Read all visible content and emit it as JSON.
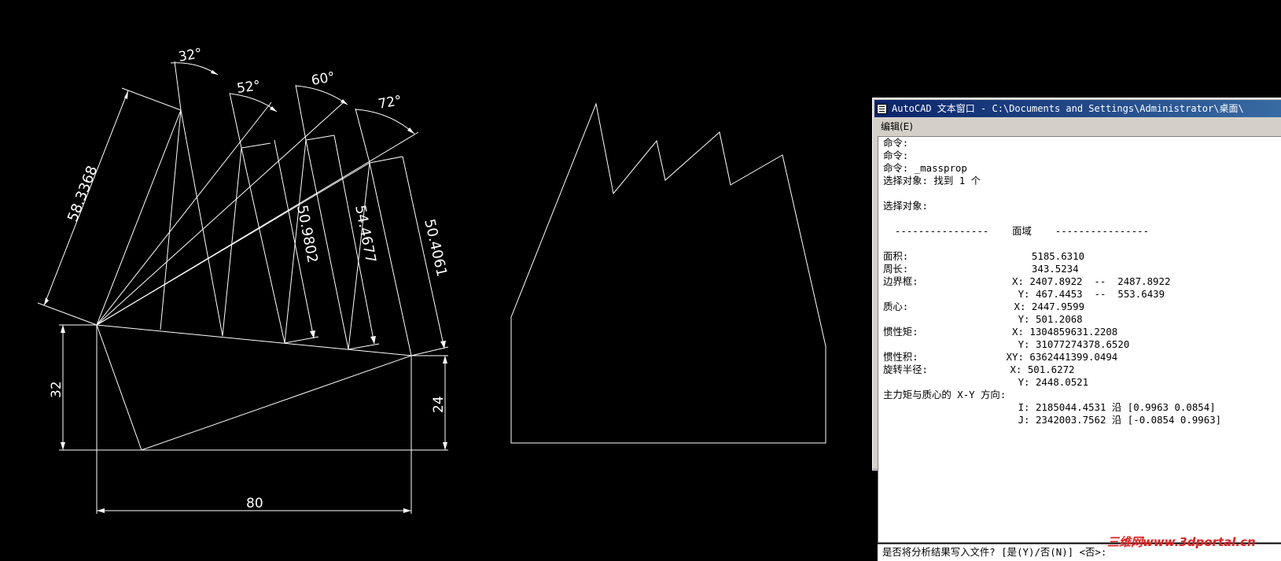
{
  "drawing": {
    "angle_labels": [
      "32°",
      "52°",
      "60°",
      "72°"
    ],
    "length_labels": [
      "58.3368",
      "50.9802",
      "54.4677",
      "50.4061"
    ],
    "dim_left": "32",
    "dim_right": "24",
    "dim_bottom": "80"
  },
  "text_window": {
    "title": "AutoCAD 文本窗口 - C:\\Documents and Settings\\Administrator\\桌面\\",
    "menu_edit": "编辑(E)",
    "lines": [
      "命令:",
      "命令:",
      "命令: _massprop",
      "选择对象: 找到 1 个",
      "",
      "选择对象:",
      "",
      "  ----------------    面域    ----------------",
      "",
      "面积:                     5185.6310",
      "周长:                     343.5234",
      "边界框:                X: 2407.8922  --  2487.8922",
      "                       Y: 467.4453  --  553.6439",
      "质心:                  X: 2447.9599",
      "                       Y: 501.2068",
      "惯性矩:                X: 1304859631.2208",
      "                       Y: 31077274378.6520",
      "惯性积:               XY: 6362441399.0494",
      "旋转半径:              X: 501.6272",
      "                       Y: 2448.0521",
      "主力矩与质心的 X-Y 方向:",
      "                       I: 2185044.4531 沿 [0.9963 0.0854]",
      "                       J: 2342003.7562 沿 [-0.0854 0.9963]"
    ],
    "command_prompt": "是否将分析结果写入文件? [是(Y)/否(N)] <否>:"
  },
  "watermark": "三维网www.3dportal.cn"
}
